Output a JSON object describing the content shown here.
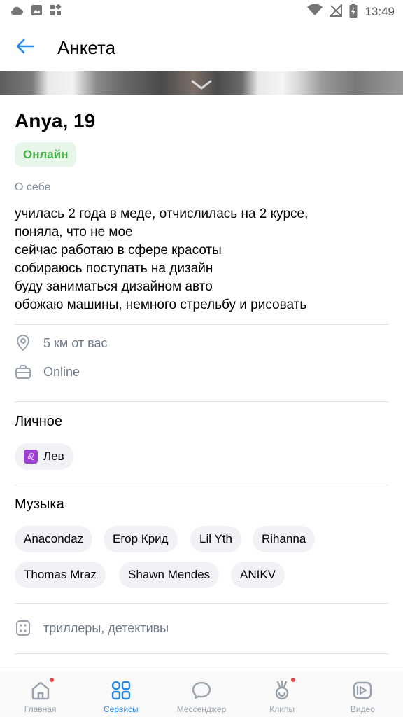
{
  "status_bar": {
    "time": "13:49",
    "left_icons": [
      "cloud-icon",
      "image-icon",
      "widgets-icon"
    ],
    "right_icons": [
      "wifi-icon",
      "no-signal-icon",
      "battery-charging-icon"
    ]
  },
  "header": {
    "back_icon": "arrow-left-icon",
    "title": "Анкета"
  },
  "profile": {
    "name": "Anya, 19",
    "status": "Онлайн",
    "about_label": "О себе",
    "about_text": "училась 2 года в меде, отчислилась на 2 курсе,\nпоняла, что не мое\nсейчас работаю в сфере красоты\nсобираюсь поступать на дизайн\nбуду заниматься дизайном авто\nобожаю машины, немного стрельбу и рисовать"
  },
  "info": {
    "distance": "5 км от вас",
    "work": "Online"
  },
  "personal": {
    "title": "Личное",
    "zodiac_symbol": "♌",
    "zodiac": "Лев"
  },
  "music": {
    "title": "Музыка",
    "artists": [
      "Anacondaz",
      "Егор Крид",
      "Lil Yth",
      "Rihanna",
      "Thomas Mraz",
      "Shawn Mendes",
      "ANIKV"
    ]
  },
  "interests": {
    "genres": "триллеры, детективы"
  },
  "tab_bar": {
    "tabs": [
      {
        "label": "Главная",
        "icon": "home-icon",
        "badge": true
      },
      {
        "label": "Сервисы",
        "icon": "services-icon",
        "active": true
      },
      {
        "label": "Мессенджер",
        "icon": "messenger-icon"
      },
      {
        "label": "Клипы",
        "icon": "clips-icon",
        "badge": true
      },
      {
        "label": "Видео",
        "icon": "video-icon"
      }
    ]
  },
  "colors": {
    "accent": "#2688eb",
    "online": "#4bb34b",
    "badge": "#e64646",
    "secondary_text": "#818c99"
  }
}
